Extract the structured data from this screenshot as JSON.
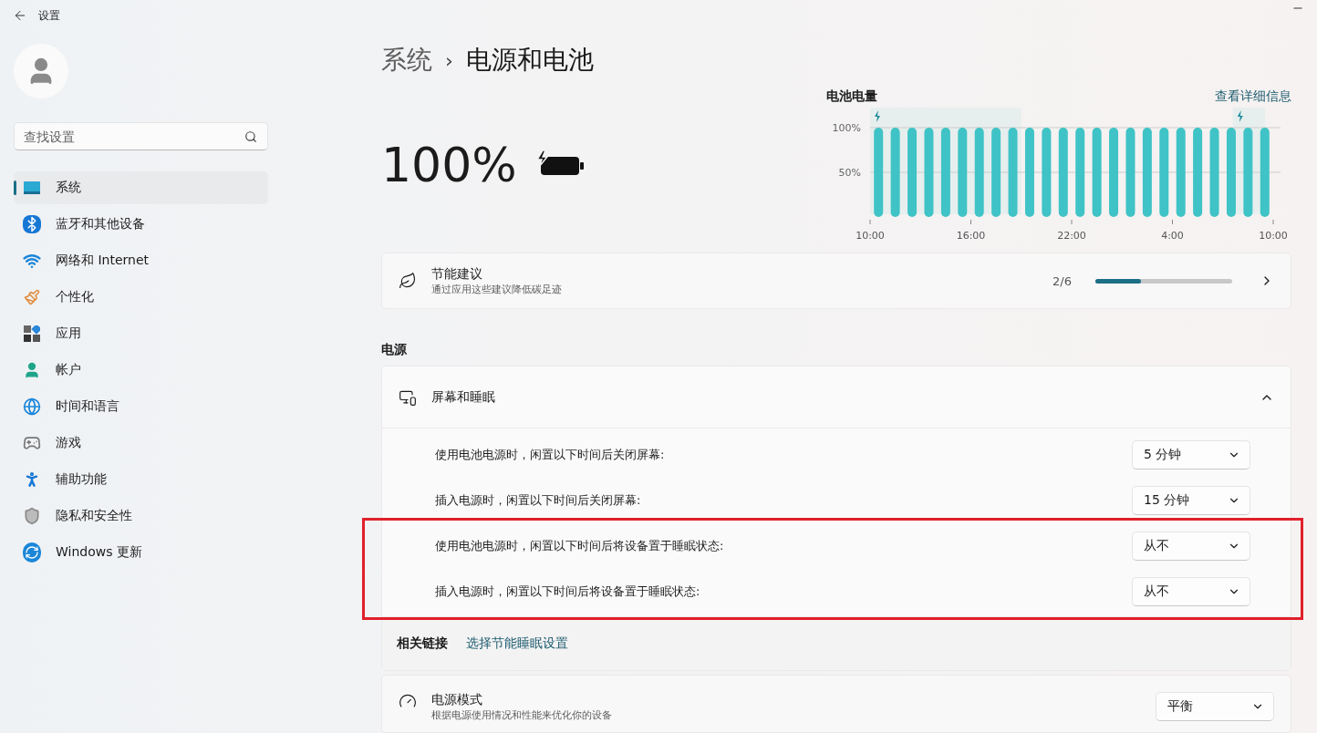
{
  "window": {
    "title": "设置"
  },
  "search": {
    "placeholder": "查找设置"
  },
  "nav": [
    {
      "label": "系统",
      "selected": true
    },
    {
      "label": "蓝牙和其他设备",
      "selected": false
    },
    {
      "label": "网络和 Internet",
      "selected": false
    },
    {
      "label": "个性化",
      "selected": false
    },
    {
      "label": "应用",
      "selected": false
    },
    {
      "label": "帐户",
      "selected": false
    },
    {
      "label": "时间和语言",
      "selected": false
    },
    {
      "label": "游戏",
      "selected": false
    },
    {
      "label": "辅助功能",
      "selected": false
    },
    {
      "label": "隐私和安全性",
      "selected": false
    },
    {
      "label": "Windows 更新",
      "selected": false
    }
  ],
  "breadcrumb": {
    "parent": "系统",
    "separator": "›",
    "current": "电源和电池"
  },
  "battery": {
    "percent": "100%",
    "charging": true
  },
  "battery_chart": {
    "link": "查看详细信息",
    "chart_data": {
      "type": "bar",
      "title": "电池电量",
      "categories": [
        "10:00",
        null,
        null,
        null,
        null,
        null,
        "16:00",
        null,
        null,
        null,
        null,
        null,
        "22:00",
        null,
        null,
        null,
        null,
        null,
        "4:00",
        null,
        null,
        null,
        null,
        null,
        "10:00"
      ],
      "values": [
        100,
        100,
        100,
        100,
        100,
        100,
        100,
        100,
        100,
        100,
        100,
        100,
        100,
        100,
        100,
        100,
        100,
        100,
        100,
        100,
        100,
        100,
        100,
        100,
        null
      ],
      "ylim": [
        0,
        100
      ],
      "yticks": [
        {
          "value": 50,
          "label": "50%"
        },
        {
          "value": 100,
          "label": "100%"
        }
      ]
    }
  },
  "recommendations": {
    "title": "节能建议",
    "subtitle": "通过应用这些建议降低碳足迹",
    "count": "2/6",
    "level": 0.33
  },
  "power_section": {
    "heading": "电源"
  },
  "screen_sleep": {
    "title": "屏幕和睡眠",
    "expanded": true,
    "rows": [
      {
        "label": "使用电池电源时，闲置以下时间后关闭屏幕:",
        "value": "5 分钟",
        "highlighted": false
      },
      {
        "label": "插入电源时，闲置以下时间后关闭屏幕:",
        "value": "15 分钟",
        "highlighted": false
      },
      {
        "label": "使用电池电源时，闲置以下时间后将设备置于睡眠状态:",
        "value": "从不",
        "highlighted": true
      },
      {
        "label": "插入电源时，闲置以下时间后将设备置于睡眠状态:",
        "value": "从不",
        "highlighted": true
      }
    ]
  },
  "related_links": {
    "label": "相关链接",
    "link": "选择节能睡眠设置"
  },
  "power_mode": {
    "title": "电源模式",
    "subtitle": "根据电源使用情况和性能来优化你的设备",
    "value": "平衡"
  }
}
